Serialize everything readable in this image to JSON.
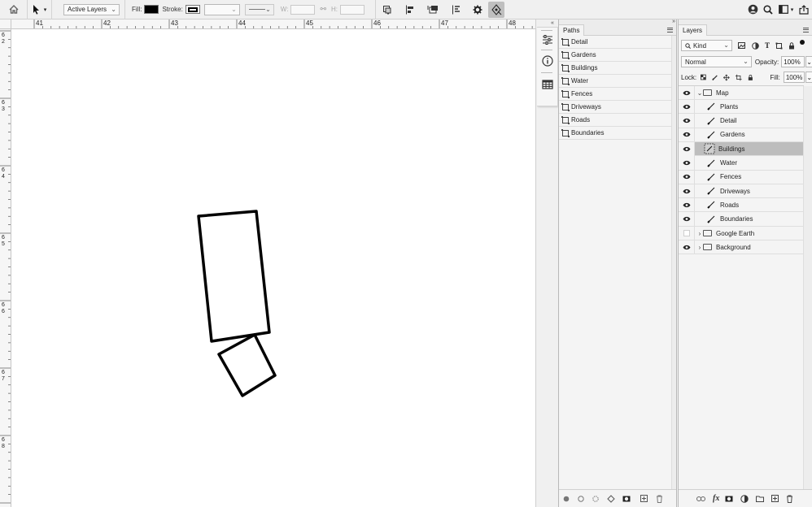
{
  "options_bar": {
    "home_icon": "home-icon",
    "tool_icon": "path-selection-icon",
    "select_mode": "Active Layers",
    "fill_label": "Fill:",
    "stroke_label": "Stroke:",
    "w_label": "W:",
    "h_label": "H:",
    "w_value": "",
    "h_value": "",
    "link_icon": "link-icon",
    "icons": [
      "path-operations-icon",
      "path-alignment-icon",
      "path-arrangement-icon",
      "align-edges-icon",
      "gear-icon",
      "constrain-path-dragging-icon"
    ],
    "right_icons": [
      "account-icon",
      "search-icon",
      "workspace-icon",
      "share-icon"
    ]
  },
  "rulers": {
    "top_labels": [
      "41",
      "42",
      "43",
      "44",
      "45",
      "46",
      "47",
      "48"
    ],
    "left_labels": [
      "6\n2",
      "6\n3",
      "6\n4",
      "6\n5",
      "6\n6",
      "6\n7",
      "6\n8"
    ]
  },
  "icon_strip": [
    "adjustments-icon",
    "info-icon",
    "table-icon"
  ],
  "paths_panel": {
    "title": "Paths",
    "paths": [
      "Detail",
      "Gardens",
      "Buildings",
      "Water",
      "Fences",
      "Driveways",
      "Roads",
      "Boundaries"
    ],
    "footer_icons": [
      "fill-path-icon",
      "stroke-path-icon",
      "load-selection-icon",
      "make-path-icon",
      "add-mask-icon",
      "new-path-icon",
      "delete-icon"
    ]
  },
  "layers_panel": {
    "title": "Layers",
    "filter_kind": "Kind",
    "blend_mode": "Normal",
    "opacity_label": "Opacity:",
    "opacity_value": "100%",
    "lock_label": "Lock:",
    "fill_label": "Fill:",
    "fill_value": "100%",
    "layers": [
      {
        "name": "Map",
        "type": "group",
        "visible": true,
        "expanded": true,
        "indent": 0
      },
      {
        "name": "Plants",
        "type": "shape",
        "visible": true,
        "indent": 1
      },
      {
        "name": "Detail",
        "type": "shape",
        "visible": true,
        "indent": 1
      },
      {
        "name": "Gardens",
        "type": "shape",
        "visible": true,
        "indent": 1
      },
      {
        "name": "Buildings",
        "type": "shape",
        "visible": true,
        "indent": 1,
        "selected": true
      },
      {
        "name": "Water",
        "type": "shape",
        "visible": true,
        "indent": 1
      },
      {
        "name": "Fences",
        "type": "shape",
        "visible": true,
        "indent": 1
      },
      {
        "name": "Driveways",
        "type": "shape",
        "visible": true,
        "indent": 1
      },
      {
        "name": "Roads",
        "type": "shape",
        "visible": true,
        "indent": 1
      },
      {
        "name": "Boundaries",
        "type": "shape",
        "visible": true,
        "indent": 1
      },
      {
        "name": "Google Earth",
        "type": "group",
        "visible": false,
        "expanded": false,
        "indent": 0
      },
      {
        "name": "Background",
        "type": "group",
        "visible": true,
        "expanded": false,
        "indent": 0
      }
    ],
    "footer_icons": [
      "link-layers-icon",
      "fx-icon",
      "layer-mask-icon",
      "adjustment-layer-icon",
      "new-group-icon",
      "new-layer-icon",
      "delete-icon"
    ]
  },
  "colors": {
    "selected_row": "#bdbdbd",
    "canvas": "#ffffff",
    "shape_stroke": "#000000"
  }
}
